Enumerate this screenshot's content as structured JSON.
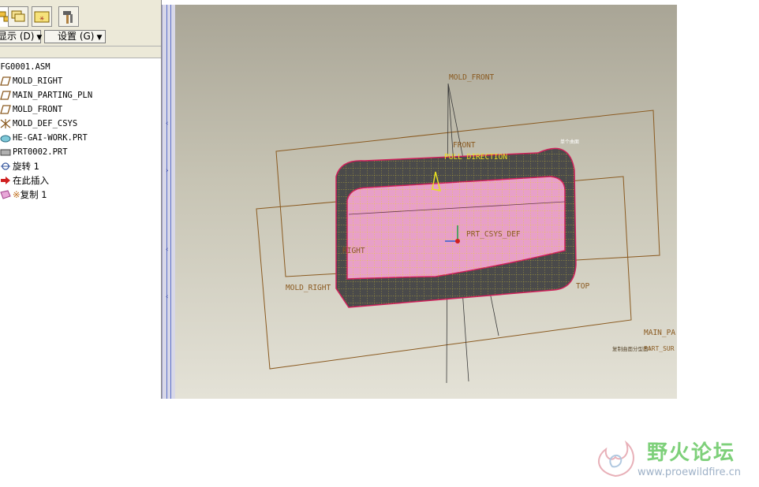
{
  "toolbar": {
    "buttons": [
      "model-tree-tab",
      "layers-tab",
      "favorites-tab",
      "tools-tab"
    ]
  },
  "menu": {
    "show_label": "显示 (D)",
    "settings_label": "设置 (G)"
  },
  "tree": {
    "items": [
      {
        "label": "MFG0001.ASM",
        "icon": "assembly-icon"
      },
      {
        "label": "MOLD_RIGHT",
        "icon": "datum-plane-icon"
      },
      {
        "label": "MAIN_PARTING_PLN",
        "icon": "datum-plane-icon"
      },
      {
        "label": "MOLD_FRONT",
        "icon": "datum-plane-icon"
      },
      {
        "label": "MOLD_DEF_CSYS",
        "icon": "coordinate-system-icon"
      },
      {
        "label": "HE-GAI-WORK.PRT",
        "icon": "workpiece-icon"
      },
      {
        "label": "PRT0002.PRT",
        "icon": "part-icon"
      },
      {
        "label": "旋转 1",
        "icon": "revolve-icon"
      },
      {
        "label": "在此插入",
        "icon": "insert-here-arrow-icon"
      },
      {
        "label": "复制 1",
        "icon": "copy-surface-icon"
      }
    ]
  },
  "viewport": {
    "labels": {
      "mold_front": "MOLD_FRONT",
      "front": "FRONT",
      "pull_direction": "PULL DIRECTION",
      "prt_csys": "PRT_CSYS_DEF",
      "right": "RIGHT",
      "mold_right": "MOLD_RIGHT",
      "top": "TOP",
      "main_pa": "MAIN_PA",
      "part_sur": "PART_SUR",
      "part_sur_prefix": "复制曲面分型面:",
      "corner_note": "单个曲面"
    },
    "colors": {
      "datum": "#8a5a20",
      "part_fill": "#e8a0c8",
      "part_edge": "#d0205a",
      "mesh": "#e6d22a",
      "body_dark": "#4a4a4a"
    }
  },
  "watermark": {
    "title": "野火论坛",
    "url": "www.proewildfire.cn"
  }
}
